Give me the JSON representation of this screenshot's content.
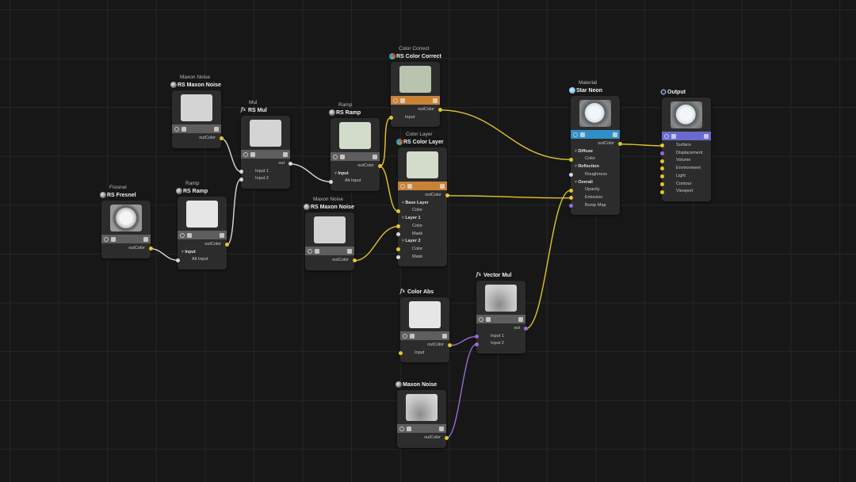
{
  "colors": {
    "yellow": "#e2c62c",
    "white": "#d8d8d8",
    "purple": "#9a6ad8",
    "orange": "#c88236",
    "blue": "#2f8fc8",
    "violet": "#6a6ad0",
    "gray": "#5e5e5e"
  },
  "nodes": [
    {
      "id": "fresnel",
      "subtitle": "Fresnel",
      "title": "RS Fresnel",
      "icon": "globe",
      "bar": "gray",
      "preview": "fresnel",
      "rows": [
        {
          "k": "out",
          "label": "outColor",
          "c": "yellow"
        }
      ]
    },
    {
      "id": "maxon_noise_1",
      "subtitle": "Maxon Noise",
      "title": "RS Maxon Noise",
      "icon": "globe",
      "bar": "gray",
      "preview": "noise",
      "rows": [
        {
          "k": "out",
          "label": "outColor",
          "c": "yellow"
        }
      ]
    },
    {
      "id": "ramp_1",
      "subtitle": "Ramp",
      "title": "RS Ramp",
      "icon": "globe",
      "bar": "gray",
      "preview": "white",
      "rows": [
        {
          "k": "out",
          "label": "outColor",
          "c": "yellow"
        },
        {
          "k": "grp",
          "label": "Input"
        },
        {
          "k": "in",
          "label": "Alt Input",
          "c": "white"
        }
      ]
    },
    {
      "id": "mul",
      "subtitle": "Mul",
      "title": "RS Mul",
      "icon": "fx",
      "bar": "gray",
      "preview": "noise",
      "rows": [
        {
          "k": "out",
          "label": "out",
          "c": "white"
        },
        {
          "k": "in",
          "label": "Input 1",
          "c": "white"
        },
        {
          "k": "in",
          "label": "Input 2",
          "c": "white"
        }
      ]
    },
    {
      "id": "ramp_2",
      "subtitle": "Ramp",
      "title": "RS Ramp",
      "icon": "globe",
      "bar": "gray",
      "preview": "mint",
      "rows": [
        {
          "k": "out",
          "label": "outColor",
          "c": "yellow"
        },
        {
          "k": "grp",
          "label": "Input"
        },
        {
          "k": "in",
          "label": "Alt Input",
          "c": "white"
        }
      ]
    },
    {
      "id": "maxon_noise_2",
      "subtitle": "Maxon Noise",
      "title": "RS Maxon Noise",
      "icon": "globe",
      "bar": "gray",
      "preview": "lightgray",
      "rows": [
        {
          "k": "out",
          "label": "outColor",
          "c": "yellow"
        }
      ]
    },
    {
      "id": "color_correct",
      "subtitle": "Color Correct",
      "title": "RS Color Correct",
      "icon": "layers",
      "bar": "orange",
      "preview": "sage",
      "rows": [
        {
          "k": "out",
          "label": "outColor",
          "c": "yellow"
        },
        {
          "k": "in",
          "label": "Input",
          "c": "yellow"
        }
      ]
    },
    {
      "id": "color_layer",
      "subtitle": "Color Layer",
      "title": "RS Color Layer",
      "icon": "layers",
      "bar": "orange",
      "preview": "mint",
      "rows": [
        {
          "k": "out",
          "label": "outColor",
          "c": "yellow"
        },
        {
          "k": "grp",
          "label": "Base Layer"
        },
        {
          "k": "in",
          "label": "Color",
          "c": "yellow"
        },
        {
          "k": "grp",
          "label": "Layer 1"
        },
        {
          "k": "in",
          "label": "Color",
          "c": "yellow"
        },
        {
          "k": "in",
          "label": "Mask",
          "c": "white"
        },
        {
          "k": "grp",
          "label": "Layer 2"
        },
        {
          "k": "in",
          "label": "Color",
          "c": "yellow"
        },
        {
          "k": "in",
          "label": "Mask",
          "c": "white"
        }
      ]
    },
    {
      "id": "color_abs",
      "subtitle": "",
      "title": "Color Abs",
      "icon": "fx",
      "bar": "gray",
      "preview": "white",
      "rows": [
        {
          "k": "out",
          "label": "outColor",
          "c": "yellow"
        },
        {
          "k": "in",
          "label": "Input",
          "c": "yellow"
        }
      ]
    },
    {
      "id": "vector_mul",
      "subtitle": "",
      "title": "Vector Mul",
      "icon": "fx",
      "bar": "gray",
      "preview": "cloud",
      "rows": [
        {
          "k": "out",
          "label": "out",
          "c": "purple"
        },
        {
          "k": "in",
          "label": "Input 1",
          "c": "purple"
        },
        {
          "k": "in",
          "label": "Input 2",
          "c": "purple"
        }
      ]
    },
    {
      "id": "maxon_noise_3",
      "subtitle": "",
      "title": "Maxon Noise",
      "icon": "globe",
      "bar": "gray",
      "preview": "cloud",
      "rows": [
        {
          "k": "out",
          "label": "outColor",
          "c": "yellow"
        }
      ]
    },
    {
      "id": "material",
      "subtitle": "Material",
      "title": "Star Neon",
      "icon": "mat",
      "bar": "blue",
      "preview": "sphere",
      "rows": [
        {
          "k": "out",
          "label": "outColor",
          "c": "yellow"
        },
        {
          "k": "grp",
          "label": "Diffuse"
        },
        {
          "k": "in",
          "label": "Color",
          "c": "yellow"
        },
        {
          "k": "grp",
          "label": "Reflection"
        },
        {
          "k": "in",
          "label": "Roughness",
          "c": "white"
        },
        {
          "k": "grp",
          "label": "Overall"
        },
        {
          "k": "in",
          "label": "Opacity",
          "c": "yellow"
        },
        {
          "k": "in",
          "label": "Emission",
          "c": "yellow"
        },
        {
          "k": "in",
          "label": "Bump Map",
          "c": "purple"
        }
      ]
    },
    {
      "id": "output",
      "subtitle": "",
      "title": "Output",
      "icon": "out",
      "bar": "violet",
      "preview": "sphere",
      "rows": [
        {
          "k": "in",
          "label": "Surface",
          "c": "yellow"
        },
        {
          "k": "in",
          "label": "Displacement",
          "c": "purple"
        },
        {
          "k": "in",
          "label": "Volume",
          "c": "yellow"
        },
        {
          "k": "in",
          "label": "Environment",
          "c": "yellow"
        },
        {
          "k": "in",
          "label": "Light",
          "c": "yellow"
        },
        {
          "k": "in",
          "label": "Contour",
          "c": "yellow"
        },
        {
          "k": "in",
          "label": "Viewport",
          "c": "yellow"
        }
      ]
    }
  ],
  "connections": [
    {
      "from": "maxon_noise_1.0",
      "to": "mul.1",
      "c": "white"
    },
    {
      "from": "ramp_1.0",
      "to": "mul.2",
      "c": "white"
    },
    {
      "from": "fresnel.0",
      "to": "ramp_1.2",
      "c": "white"
    },
    {
      "from": "mul.0",
      "to": "ramp_2.2",
      "c": "white"
    },
    {
      "from": "ramp_2.0",
      "to": "color_correct.1",
      "c": "yellow"
    },
    {
      "from": "ramp_2.0",
      "to": "color_layer.2",
      "c": "yellow"
    },
    {
      "from": "maxon_noise_2.0",
      "to": "color_layer.4",
      "c": "yellow"
    },
    {
      "from": "color_correct.0",
      "to": "material.2",
      "c": "yellow"
    },
    {
      "from": "color_layer.0",
      "to": "material.7",
      "c": "yellow"
    },
    {
      "from": "vector_mul.0",
      "to": "material.6",
      "c": "yellow"
    },
    {
      "from": "material.0",
      "to": "output.0",
      "c": "yellow"
    },
    {
      "from": "color_abs.0",
      "to": "vector_mul.1",
      "c": "purple"
    },
    {
      "from": "maxon_noise_3.0",
      "to": "vector_mul.2",
      "c": "purple"
    }
  ]
}
